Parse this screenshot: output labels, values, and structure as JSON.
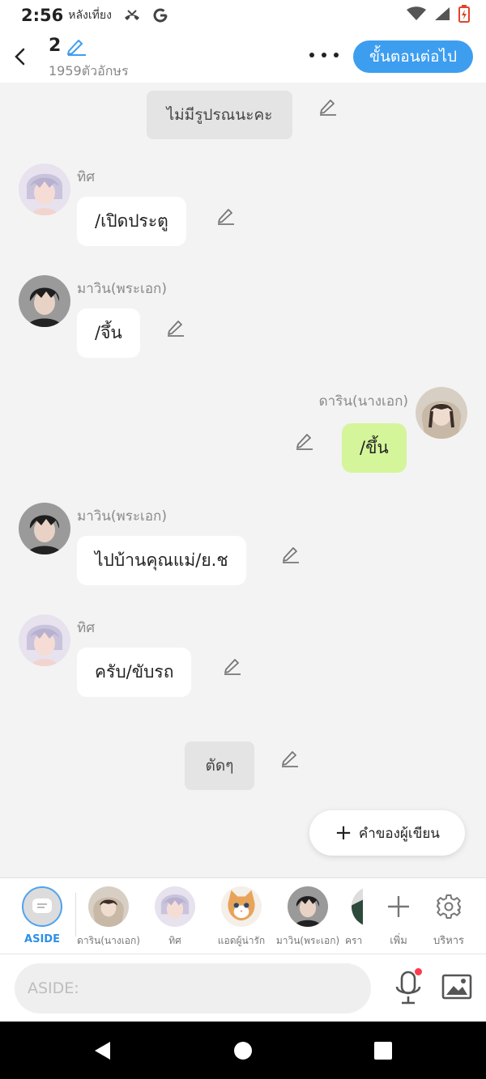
{
  "status_bar": {
    "time": "2:56",
    "meridiem": "หลังเที่ยง"
  },
  "header": {
    "title": "2",
    "char_count": "1959ตัวอักษร",
    "next_label": "ขั้นตอนต่อไป"
  },
  "messages": [
    {
      "type": "narration",
      "text": "ไม่มีรูปรณนะคะ"
    },
    {
      "type": "left",
      "name": "ทิศ",
      "text": "/เปิดประตู",
      "avatar": "silver-hair"
    },
    {
      "type": "left",
      "name": "มาวิน(พระเอก)",
      "text": "/จึ้น",
      "avatar": "dark-hair"
    },
    {
      "type": "right",
      "name": "ดาริน(นางเอก)",
      "text": "/ขึ้น",
      "avatar": "girl"
    },
    {
      "type": "left",
      "name": "มาวิน(พระเอก)",
      "text": "ไปบ้านคุณแม่/ย.ช",
      "avatar": "dark-hair"
    },
    {
      "type": "left",
      "name": "ทิศ",
      "text": "ครับ/ขับรถ",
      "avatar": "silver-hair"
    },
    {
      "type": "narration",
      "text": "ตัดๆ"
    }
  ],
  "author_button": {
    "label": "คำของผู้เขียน"
  },
  "character_bar": {
    "items": [
      {
        "label": "ASIDE"
      },
      {
        "label": "ดาริน(นางเอก)"
      },
      {
        "label": "ทิศ"
      },
      {
        "label": "แอดผู้น่ารัก"
      },
      {
        "label": "มาวิน(พระเอก)"
      },
      {
        "label": "คราม"
      }
    ],
    "add_label": "เพิ่ม",
    "manage_label": "บริหาร"
  },
  "input": {
    "placeholder": "ASIDE:"
  },
  "colors": {
    "accent": "#3d9ef0",
    "my_bubble": "#d4f59a",
    "background": "#f3f3f3",
    "notification_dot": "#ff3b4e"
  },
  "icons": [
    "back-icon",
    "pencil-icon",
    "more-icon",
    "plus-icon",
    "gear-icon",
    "mic-icon",
    "image-icon",
    "aside-chat-icon",
    "wifi-icon",
    "signal-icon",
    "battery-icon",
    "missed-call-icon",
    "google-icon"
  ]
}
